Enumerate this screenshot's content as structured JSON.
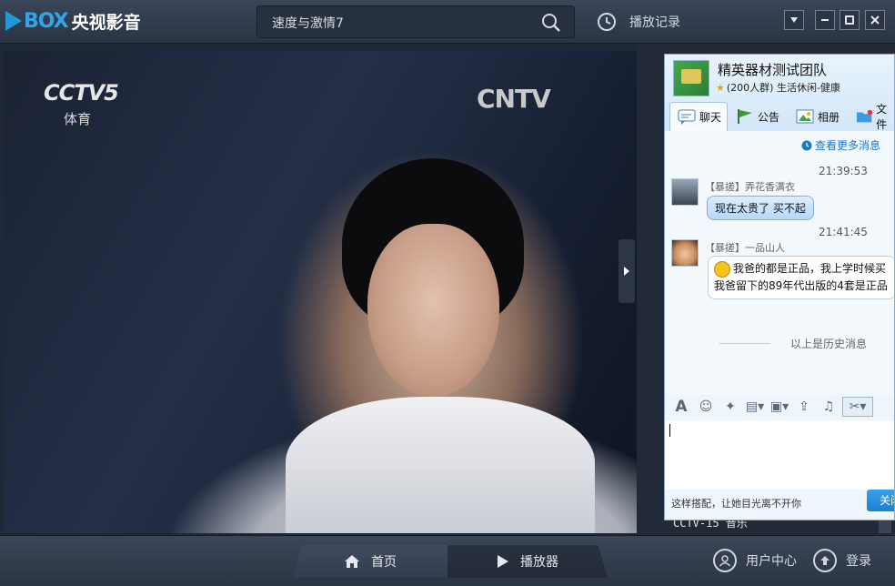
{
  "app": {
    "logo_box": "BOX",
    "logo_cn": "央视影音"
  },
  "search": {
    "value": "速度与激情7"
  },
  "history": {
    "label": "播放记录"
  },
  "video": {
    "channel_logo": "CCTV5",
    "channel_sub": "体育",
    "watermark": "CNTV"
  },
  "chat": {
    "group_name": "精英器材测试团队",
    "group_meta": "(200人群) 生活休闲-健康",
    "tabs": [
      {
        "label": "聊天"
      },
      {
        "label": "公告"
      },
      {
        "label": "相册"
      },
      {
        "label": "文件"
      }
    ],
    "more_messages": "查看更多消息",
    "messages": [
      {
        "time": "21:39:53",
        "sender": "【暴搓】弄花香满衣",
        "text": "现在太贵了  买不起"
      },
      {
        "time": "21:41:45",
        "sender": "【暴搓】一品山人",
        "line1": "我爸的都是正品，我上学时候买",
        "line2": "我爸留下的89年代出版的4套是正品"
      }
    ],
    "history_divider": "以上是历史消息",
    "ad_text": "这样搭配，让她目光离不开你",
    "close_label": "关闭"
  },
  "channel_panel": {
    "current_channel": "CCTV-15 音乐"
  },
  "bottom": {
    "home_label": "首页",
    "player_label": "播放器",
    "user_center_label": "用户中心",
    "login_label": "登录"
  },
  "colors": {
    "accent": "#1e9ad8",
    "chat_bubble": "#b7d7f5",
    "close_button": "#1d7fd0"
  }
}
